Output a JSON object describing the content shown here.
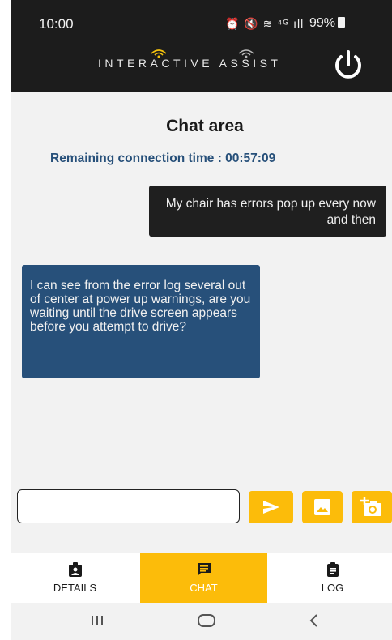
{
  "status_bar": {
    "time": "10:00",
    "icons": [
      "alarm-icon",
      "mute-icon",
      "wifi-icon",
      "4g-icon",
      "signal-icon"
    ],
    "icons_text": "⏰ 🔇 ≋ ⁴ᴳ ıll",
    "battery": "99%"
  },
  "app_bar": {
    "brand": "INTERACTIVE ASSIST",
    "brand_part1": "INTERACTIVE",
    "brand_part2": "ASSIST",
    "accent_color": "#f4c20d"
  },
  "chat": {
    "title": "Chat area",
    "remaining_label": "Remaining connection time : 00:57:09",
    "messages": [
      {
        "from": "user",
        "text": "My chair has errors pop up every now and then"
      },
      {
        "from": "agent",
        "text": "I can see from the error log several out of center at power up warnings, are you waiting until the drive screen appears before you attempt to drive?"
      }
    ]
  },
  "composer": {
    "value": "",
    "send_icon": "send-icon",
    "image_icon": "image-icon",
    "camera_icon": "add-photo-icon",
    "button_color": "#fcbc0a"
  },
  "nav": {
    "items": [
      {
        "label": "DETAILS",
        "icon": "badge-icon",
        "active": false
      },
      {
        "label": "CHAT",
        "icon": "chat-icon",
        "active": true
      },
      {
        "label": "LOG",
        "icon": "clipboard-icon",
        "active": false
      }
    ]
  },
  "system_nav": [
    "recents-icon",
    "home-icon",
    "back-icon"
  ]
}
